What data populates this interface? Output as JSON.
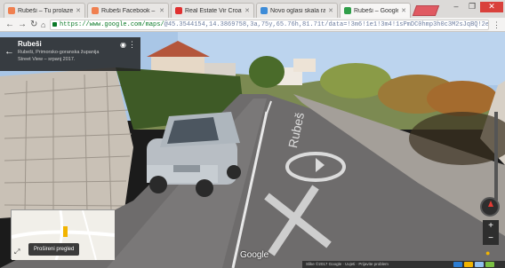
{
  "browser": {
    "tabs": [
      {
        "label": "Rubeši – Tu prolaze a",
        "color": "#f08050",
        "active": false
      },
      {
        "label": "Rubeši Facebook – 6.5",
        "color": "#f08050",
        "active": false
      },
      {
        "label": "Real Estate Vir Croatia",
        "color": "#e03030",
        "active": false
      },
      {
        "label": "Novo oglasi skala ra",
        "color": "#3d8cd8",
        "active": false
      },
      {
        "label": "Rubeši – Google karte",
        "color": "#2f9e49",
        "active": true
      }
    ],
    "window_buttons": [
      "–",
      "❐",
      "✕"
    ],
    "url_main": "https://www.google.com/maps/",
    "url_rest": "@45.3544154,14.3869758,3a,75y,65.76h,81.71t/data=!3m6!1e1!3m4!1sPmDC0hmp3h0c3M2sJqBQ!2e0!7i13312!8i6656",
    "accent": "#0b7a28"
  },
  "streetview": {
    "place_title": "Rubeši",
    "place_address": "Rubeši, Primorsko-goranska županija",
    "capture_date": "Street View – srpanj 2017.",
    "minimap_button": "Prošireni pregled",
    "watermark": "Google",
    "status_blurb": "Slike ©2017 Google · Uvjeti · Prijavite problem",
    "chips": [
      "#2d7dd2",
      "#f2b400",
      "#8fbff0",
      "#7ac043"
    ],
    "zoom_in": "+",
    "zoom_out": "−"
  }
}
